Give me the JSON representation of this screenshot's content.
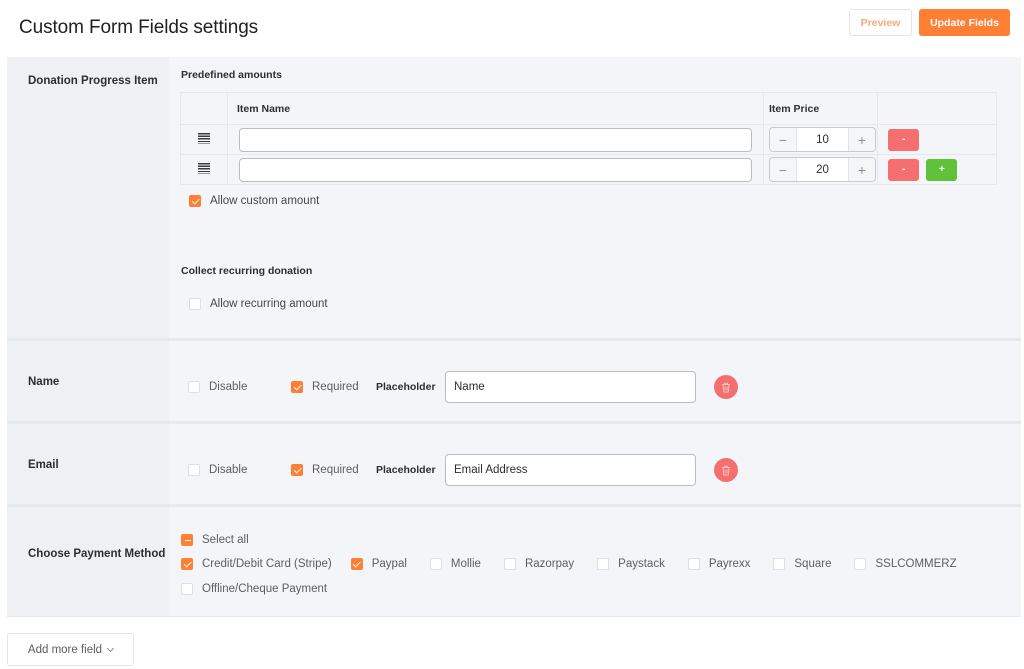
{
  "header": {
    "title": "Custom Form Fields settings",
    "preview_label": "Preview",
    "update_label": "Update Fields"
  },
  "colors": {
    "accent": "#ff7f35",
    "danger": "#f56f71",
    "success": "#60c13a"
  },
  "donation": {
    "label": "Donation Progress Item",
    "predefined_title": "Predefined amounts",
    "columns": {
      "item_name": "Item Name",
      "item_price": "Item Price"
    },
    "rows": [
      {
        "item_name": "",
        "price": "10",
        "remove_label": "-",
        "add_label": null
      },
      {
        "item_name": "",
        "price": "20",
        "remove_label": "-",
        "add_label": "+"
      }
    ],
    "stepper_minus": "−",
    "stepper_plus": "+",
    "allow_custom_label": "Allow custom amount",
    "allow_custom_checked": true,
    "recurring_title": "Collect recurring donation",
    "allow_recurring_label": "Allow recurring amount",
    "allow_recurring_checked": false
  },
  "name_field": {
    "label": "Name",
    "disable_label": "Disable",
    "disable_checked": false,
    "required_label": "Required",
    "required_checked": true,
    "placeholder_label": "Placeholder",
    "placeholder_value": "Name"
  },
  "email_field": {
    "label": "Email",
    "disable_label": "Disable",
    "disable_checked": false,
    "required_label": "Required",
    "required_checked": true,
    "placeholder_label": "Placeholder",
    "placeholder_value": "Email Address"
  },
  "payment": {
    "label": "Choose Payment Method",
    "select_all_label": "Select all",
    "select_all_state": "indeterminate",
    "methods": [
      {
        "label": "Credit/Debit Card (Stripe)",
        "checked": true
      },
      {
        "label": "Paypal",
        "checked": true
      },
      {
        "label": "Mollie",
        "checked": false
      },
      {
        "label": "Razorpay",
        "checked": false
      },
      {
        "label": "Paystack",
        "checked": false
      },
      {
        "label": "Payrexx",
        "checked": false
      },
      {
        "label": "Square",
        "checked": false
      },
      {
        "label": "SSLCOMMERZ",
        "checked": false
      },
      {
        "label": "Offline/Cheque Payment",
        "checked": false
      }
    ]
  },
  "footer": {
    "add_more_label": "Add more field"
  }
}
